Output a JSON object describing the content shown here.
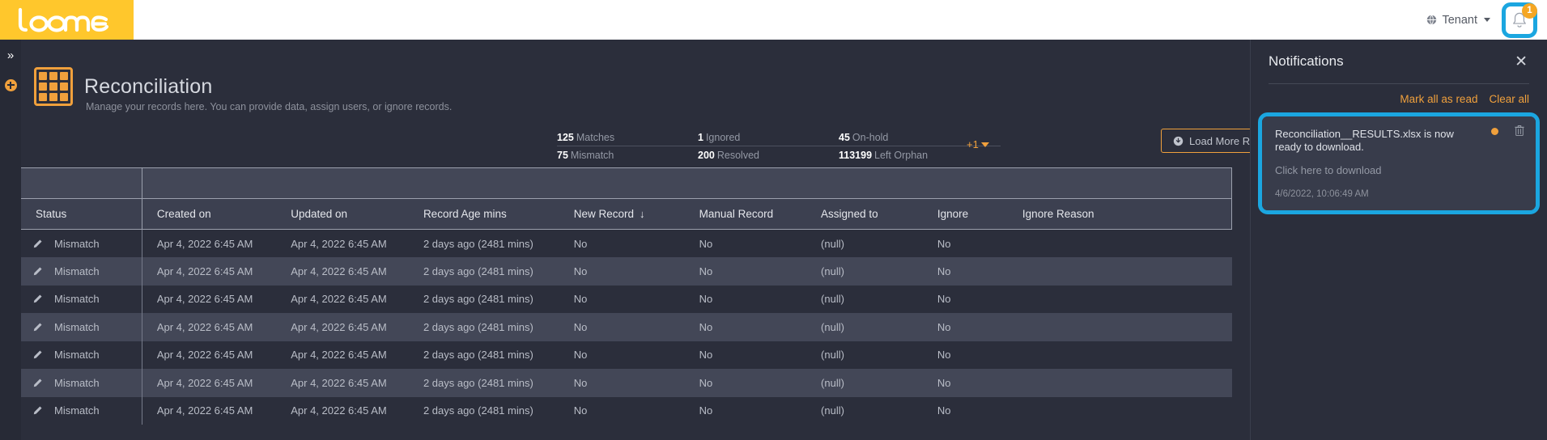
{
  "topbar": {
    "logo_text": "loome",
    "tenant_label": "Tenant",
    "globe_icon": "globe-icon",
    "caret_icon": "chevron-down-icon",
    "bell_icon": "bell-icon",
    "bell_badge_count": "1"
  },
  "rail": {
    "expand_icon": "»",
    "add_icon": "plus-circle-icon"
  },
  "page": {
    "icon": "grid-table-icon",
    "title": "Reconciliation",
    "subtitle": "Manage your records here. You can provide data, assign users, or ignore records."
  },
  "stats": {
    "columns": [
      {
        "top_value": "125",
        "top_label": "Matches",
        "bottom_value": "75",
        "bottom_label": "Mismatch"
      },
      {
        "top_value": "1",
        "top_label": "Ignored",
        "bottom_value": "200",
        "bottom_label": "Resolved"
      },
      {
        "top_value": "45",
        "top_label": "On-hold",
        "bottom_value": "113199",
        "bottom_label": "Left Orphan"
      }
    ],
    "more_label": "+1"
  },
  "toolbar": {
    "load_more_label": "Load More Rec",
    "load_more_icon": "download-circle-icon"
  },
  "table": {
    "headers": [
      "Status",
      "Created on",
      "Updated on",
      "Record Age mins",
      "New Record",
      "Manual Record",
      "Assigned to",
      "Ignore",
      "Ignore Reason"
    ],
    "sorted_column": "New Record",
    "sort_direction_icon": "arrow-down-icon",
    "rows": [
      {
        "status": "Mismatch",
        "created": "Apr 4, 2022 6:45 AM",
        "updated": "Apr 4, 2022 6:45 AM",
        "age": "2 days ago (2481 mins)",
        "new_record": "No",
        "manual_record": "No",
        "assigned_to": "(null)",
        "ignore": "No",
        "ignore_reason": ""
      },
      {
        "status": "Mismatch",
        "created": "Apr 4, 2022 6:45 AM",
        "updated": "Apr 4, 2022 6:45 AM",
        "age": "2 days ago (2481 mins)",
        "new_record": "No",
        "manual_record": "No",
        "assigned_to": "(null)",
        "ignore": "No",
        "ignore_reason": ""
      },
      {
        "status": "Mismatch",
        "created": "Apr 4, 2022 6:45 AM",
        "updated": "Apr 4, 2022 6:45 AM",
        "age": "2 days ago (2481 mins)",
        "new_record": "No",
        "manual_record": "No",
        "assigned_to": "(null)",
        "ignore": "No",
        "ignore_reason": ""
      },
      {
        "status": "Mismatch",
        "created": "Apr 4, 2022 6:45 AM",
        "updated": "Apr 4, 2022 6:45 AM",
        "age": "2 days ago (2481 mins)",
        "new_record": "No",
        "manual_record": "No",
        "assigned_to": "(null)",
        "ignore": "No",
        "ignore_reason": ""
      },
      {
        "status": "Mismatch",
        "created": "Apr 4, 2022 6:45 AM",
        "updated": "Apr 4, 2022 6:45 AM",
        "age": "2 days ago (2481 mins)",
        "new_record": "No",
        "manual_record": "No",
        "assigned_to": "(null)",
        "ignore": "No",
        "ignore_reason": ""
      },
      {
        "status": "Mismatch",
        "created": "Apr 4, 2022 6:45 AM",
        "updated": "Apr 4, 2022 6:45 AM",
        "age": "2 days ago (2481 mins)",
        "new_record": "No",
        "manual_record": "No",
        "assigned_to": "(null)",
        "ignore": "No",
        "ignore_reason": ""
      },
      {
        "status": "Mismatch",
        "created": "Apr 4, 2022 6:45 AM",
        "updated": "Apr 4, 2022 6:45 AM",
        "age": "2 days ago (2481 mins)",
        "new_record": "No",
        "manual_record": "No",
        "assigned_to": "(null)",
        "ignore": "No",
        "ignore_reason": ""
      }
    ],
    "row_edit_icon": "pencil-icon"
  },
  "notifications": {
    "title": "Notifications",
    "close_icon": "close-icon",
    "mark_all_label": "Mark all as read",
    "clear_all_label": "Clear all",
    "items": [
      {
        "message": "Reconciliation__RESULTS.xlsx is now ready to download.",
        "link_label": "Click here to download",
        "timestamp": "4/6/2022, 10:06:49 AM",
        "unread_dot": "unread-dot",
        "delete_icon": "trash-icon"
      }
    ]
  },
  "colors": {
    "brand_yellow": "#ffc72c",
    "accent_orange": "#f0a03c",
    "highlight_blue": "#1ba6e0",
    "page_bg": "#2b2e3b",
    "row_alt_bg": "#434757"
  }
}
